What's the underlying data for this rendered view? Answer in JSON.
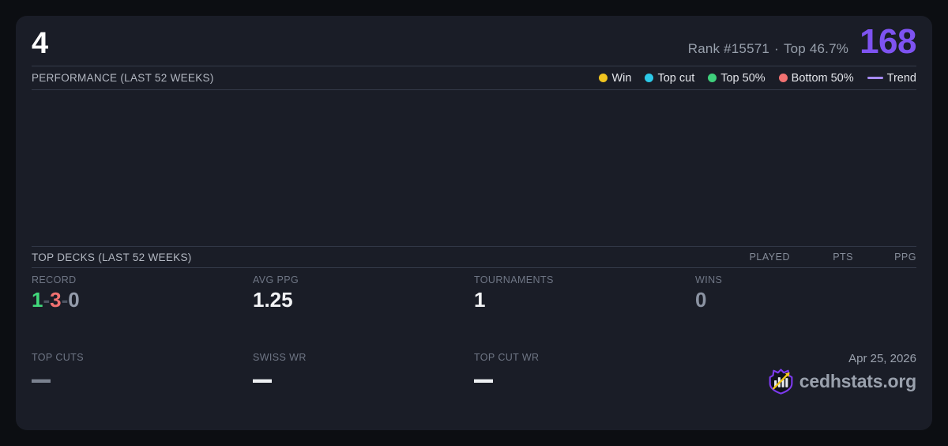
{
  "colors": {
    "accent_purple": "#7e53f1",
    "win_green": "#41d87b",
    "loss_red": "#f17171",
    "muted_gray": "#949cab",
    "divider": "#343a49"
  },
  "header": {
    "number": "4",
    "rank": "Rank #15571",
    "separator": "·",
    "top_percent": "Top 46.7%",
    "points": "168"
  },
  "performance": {
    "title": "PERFORMANCE (LAST 52 WEEKS)",
    "legend": [
      {
        "label": "Win",
        "color": "#f0c41f"
      },
      {
        "label": "Top cut",
        "color": "#2cc9e8"
      },
      {
        "label": "Top 50%",
        "color": "#3fd07c"
      },
      {
        "label": "Bottom 50%",
        "color": "#f17171"
      },
      {
        "label": "Trend",
        "color": "#a78bfa"
      }
    ]
  },
  "top_decks": {
    "title": "TOP DECKS (LAST 52 WEEKS)",
    "columns": [
      "PLAYED",
      "PTS",
      "PPG"
    ]
  },
  "stats": {
    "record": {
      "label": "RECORD",
      "wins": "1",
      "losses": "3",
      "draws": "0",
      "separator": "-"
    },
    "avg_ppg": {
      "label": "AVG PPG",
      "value": "1.25"
    },
    "tournaments": {
      "label": "TOURNAMENTS",
      "value": "1"
    },
    "wins": {
      "label": "WINS",
      "value": "0"
    },
    "top_cuts": {
      "label": "TOP CUTS",
      "value": "—"
    },
    "swiss_wr": {
      "label": "SWISS WR",
      "value": "—"
    },
    "top_cut_wr": {
      "label": "TOP CUT WR",
      "value": "—"
    }
  },
  "footer": {
    "date": "Apr 25, 2026",
    "brand": "cedhstats.org"
  }
}
